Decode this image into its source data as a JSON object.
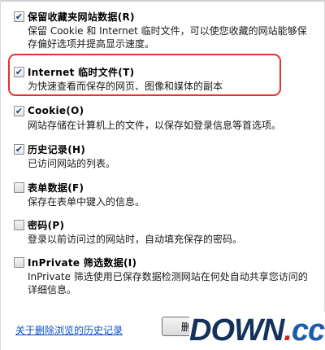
{
  "options": [
    {
      "title": "保留收藏夹网站数据(R)",
      "checked": true,
      "description": "保留 Cookie 和 Internet 临时文件，可以使您收藏的网站能够保存偏好选项并提高显示速度。"
    },
    {
      "title": "Internet 临时文件(T)",
      "checked": true,
      "description": "为快速查看而保存的网页、图像和媒体的副本"
    },
    {
      "title": "Cookie(O)",
      "checked": true,
      "description": "网站存储在计算机上的文件，以保存如登录信息等首选项。"
    },
    {
      "title": "历史记录(H)",
      "checked": true,
      "description": "已访问网站的列表。"
    },
    {
      "title": "表单数据(F)",
      "checked": false,
      "description": "保存在表单中键入的信息。"
    },
    {
      "title": "密码(P)",
      "checked": false,
      "description": "登录以前访问过的网站时，自动填充保存的密码。"
    },
    {
      "title": "InPrivate 筛选数据(I)",
      "checked": false,
      "description": "InPrivate 筛选使用已保存数据检测网站在何处自动共享您访问的详细信息。"
    }
  ],
  "footer": {
    "about_link": "关于删除浏览的历史记录",
    "delete_button": "删除(D)"
  },
  "watermark": {
    "main": "DOWN",
    "dot": ".",
    "suffix": "cc"
  },
  "colors": {
    "highlight": "#e5322f",
    "link": "#0a4fc9",
    "watermark_dark": "#14325a",
    "watermark_dot": "#d9251c"
  }
}
